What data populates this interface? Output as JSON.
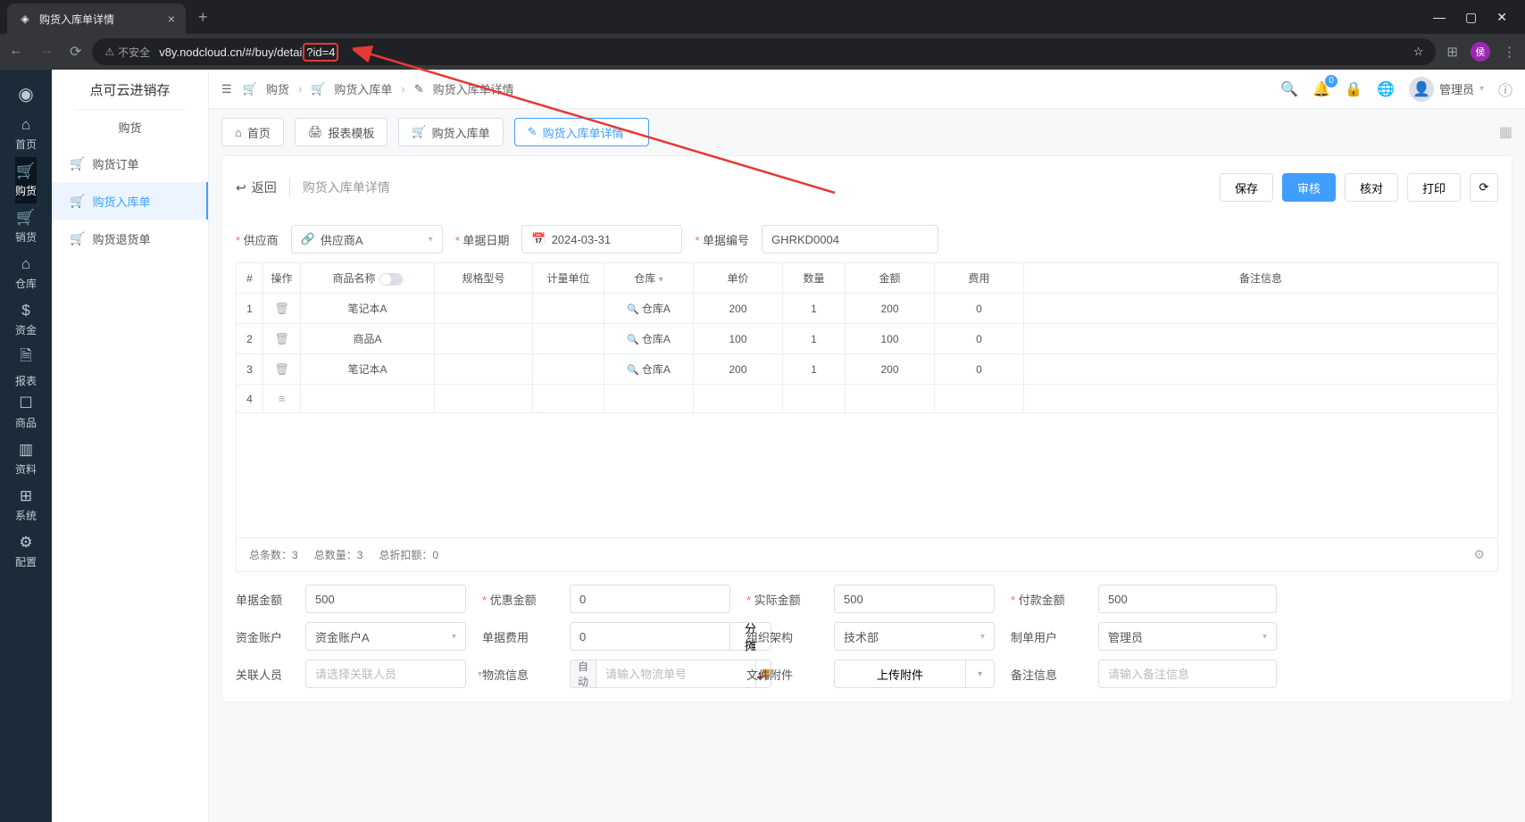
{
  "browser": {
    "tab_title": "购货入库单详情",
    "url_prefix": "v8y.nodcloud.cn/#/buy/detail",
    "url_query": "?id=4",
    "insecure_label": "不安全",
    "avatar_letter": "侯"
  },
  "rail": {
    "items": [
      {
        "icon": "⌂",
        "label": "首页"
      },
      {
        "icon": "🛒",
        "label": "购货"
      },
      {
        "icon": "🛒",
        "label": "销货"
      },
      {
        "icon": "⌂",
        "label": "仓库"
      },
      {
        "icon": "$",
        "label": "资金"
      },
      {
        "icon": "🗎",
        "label": "报表"
      },
      {
        "icon": "☐",
        "label": "商品"
      },
      {
        "icon": "▥",
        "label": "资料"
      },
      {
        "icon": "⊞",
        "label": "系统"
      },
      {
        "icon": "⚙",
        "label": "配置"
      }
    ]
  },
  "side": {
    "logo": "点可云进销存",
    "section": "购货",
    "items": [
      {
        "icon": "🛒",
        "label": "购货订单"
      },
      {
        "icon": "🛒",
        "label": "购货入库单"
      },
      {
        "icon": "🛒",
        "label": "购货退货单"
      }
    ]
  },
  "crumbs": {
    "c1": "购货",
    "c2": "购货入库单",
    "c3": "购货入库单详情"
  },
  "topright": {
    "badge": "0",
    "user": "管理员"
  },
  "tabs": {
    "items": [
      {
        "icon": "⌂",
        "label": "首页"
      },
      {
        "icon": "🖨",
        "label": "报表模板"
      },
      {
        "icon": "🛒",
        "label": "购货入库单"
      },
      {
        "icon": "✎",
        "label": "购货入库单详情"
      }
    ]
  },
  "page": {
    "back": "返回",
    "title": "购货入库单详情",
    "actions": {
      "save": "保存",
      "audit": "审核",
      "check": "核对",
      "print": "打印"
    }
  },
  "form": {
    "supplier_label": "供应商",
    "supplier_value": "供应商A",
    "date_label": "单据日期",
    "date_value": "2024-03-31",
    "docno_label": "单据编号",
    "docno_value": "GHRKD0004",
    "amount_label": "单据金额",
    "amount_value": "500",
    "discount_label": "优惠金额",
    "discount_value": "0",
    "actual_label": "实际金额",
    "actual_value": "500",
    "pay_label": "付款金额",
    "pay_value": "500",
    "account_label": "资金账户",
    "account_value": "资金账户A",
    "fee_label": "单据费用",
    "fee_value": "0",
    "share_btn": "分摊",
    "org_label": "组织架构",
    "org_value": "技术部",
    "maker_label": "制单用户",
    "maker_value": "管理员",
    "related_label": "关联人员",
    "related_ph": "请选择关联人员",
    "logi_label": "物流信息",
    "logi_tag": "自动",
    "logi_ph": "请输入物流单号",
    "file_label": "文件附件",
    "file_btn": "上传附件",
    "remark_label": "备注信息",
    "remark_ph": "请输入备注信息"
  },
  "table": {
    "cols": {
      "idx": "#",
      "op": "操作",
      "name": "商品名称",
      "spec": "规格型号",
      "unit": "计量单位",
      "wh": "仓库",
      "price": "单价",
      "qty": "数量",
      "amt": "金额",
      "fee": "费用",
      "remark": "备注信息"
    },
    "wh_value": "仓库A",
    "rows": [
      {
        "idx": "1",
        "name": "笔记本A",
        "price": "200",
        "qty": "1",
        "amt": "200",
        "fee": "0"
      },
      {
        "idx": "2",
        "name": "商品A",
        "price": "100",
        "qty": "1",
        "amt": "100",
        "fee": "0"
      },
      {
        "idx": "3",
        "name": "笔记本A",
        "price": "200",
        "qty": "1",
        "amt": "200",
        "fee": "0"
      },
      {
        "idx": "4",
        "name": "",
        "price": "",
        "qty": "",
        "amt": "",
        "fee": ""
      }
    ],
    "summary": {
      "total_rows": "总条数：3",
      "total_qty": "总数量：3",
      "total_disc": "总折扣额：0"
    }
  }
}
